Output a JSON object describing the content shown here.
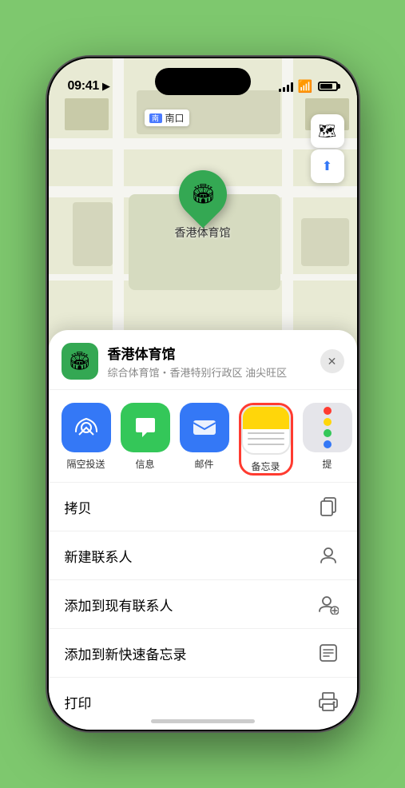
{
  "status_bar": {
    "time": "09:41",
    "location_icon": "▶"
  },
  "map": {
    "label_text": "南口",
    "pin_emoji": "🏟",
    "venue_name": "香港体育馆",
    "map_type_icon": "🗺",
    "location_icon": "⬆"
  },
  "sheet": {
    "venue_name": "香港体育馆",
    "venue_subtitle": "综合体育馆・香港特别行政区 油尖旺区",
    "venue_emoji": "🏟",
    "close_icon": "✕"
  },
  "share_items": [
    {
      "id": "airdrop",
      "label": "隔空投送",
      "emoji": "📡"
    },
    {
      "id": "messages",
      "label": "信息",
      "emoji": "💬"
    },
    {
      "id": "mail",
      "label": "邮件",
      "emoji": "✉️"
    },
    {
      "id": "notes",
      "label": "备忘录",
      "emoji": ""
    },
    {
      "id": "more",
      "label": "提",
      "emoji": "···"
    }
  ],
  "actions": [
    {
      "id": "copy",
      "label": "拷贝",
      "icon": "copy"
    },
    {
      "id": "new-contact",
      "label": "新建联系人",
      "icon": "person"
    },
    {
      "id": "add-existing",
      "label": "添加到现有联系人",
      "icon": "person-add"
    },
    {
      "id": "add-notes",
      "label": "添加到新快速备忘录",
      "icon": "notes"
    },
    {
      "id": "print",
      "label": "打印",
      "icon": "printer"
    }
  ],
  "colors": {
    "green_pin": "#34a853",
    "blue": "#3478f6",
    "red_border": "#ff3b30"
  }
}
